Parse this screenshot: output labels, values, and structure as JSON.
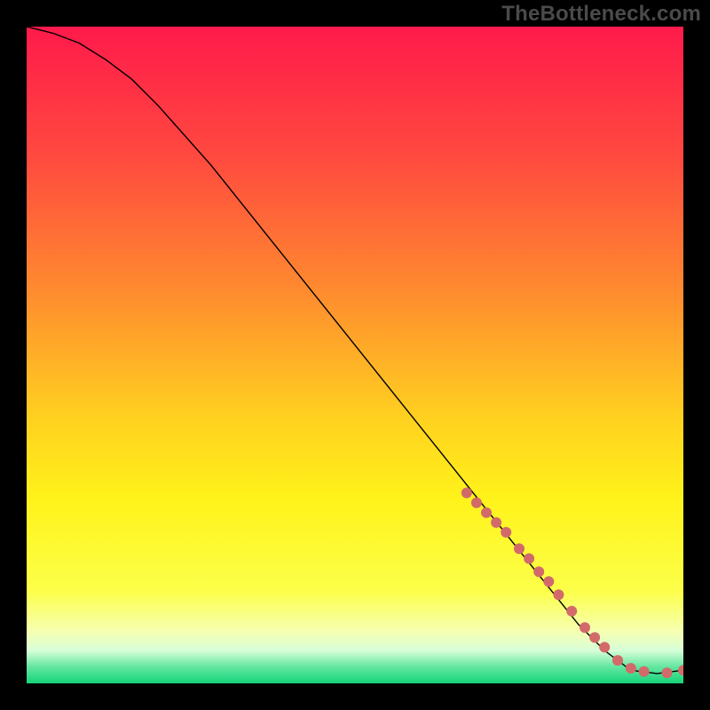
{
  "watermark": "TheBottleneck.com",
  "chart_data": {
    "type": "line",
    "title": "",
    "xlabel": "",
    "ylabel": "",
    "xlim": [
      0,
      100
    ],
    "ylim": [
      0,
      100
    ],
    "grid": false,
    "legend": false,
    "background_gradient": {
      "stops": [
        {
          "offset": 0.0,
          "color": "#ff1a4b"
        },
        {
          "offset": 0.2,
          "color": "#ff4a3f"
        },
        {
          "offset": 0.4,
          "color": "#ff8a2f"
        },
        {
          "offset": 0.6,
          "color": "#ffd21f"
        },
        {
          "offset": 0.72,
          "color": "#fff31a"
        },
        {
          "offset": 0.86,
          "color": "#fcff4a"
        },
        {
          "offset": 0.92,
          "color": "#f6ffb0"
        },
        {
          "offset": 0.95,
          "color": "#d8ffd8"
        },
        {
          "offset": 0.975,
          "color": "#62e6a0"
        },
        {
          "offset": 1.0,
          "color": "#15d47a"
        }
      ]
    },
    "series": [
      {
        "name": "bottleneck-curve",
        "stroke": "#000000",
        "strokeWidth": 1.4,
        "x": [
          0,
          4,
          8,
          12,
          16,
          20,
          24,
          28,
          32,
          36,
          40,
          44,
          48,
          52,
          56,
          60,
          64,
          68,
          72,
          76,
          80,
          84,
          88,
          92,
          96,
          100
        ],
        "y": [
          100,
          99,
          97.5,
          95,
          92,
          88,
          83.5,
          79,
          74,
          69,
          64,
          59,
          54,
          49,
          44,
          39,
          34,
          29,
          24,
          19,
          14,
          9,
          5,
          2,
          1.5,
          2
        ]
      },
      {
        "name": "highlight-points",
        "type": "scatter",
        "stroke": "none",
        "fill": "#d36a6a",
        "radius": 6,
        "x": [
          67,
          68.5,
          70,
          71.5,
          73,
          75,
          76.5,
          78,
          79.5,
          81,
          83,
          85,
          86.5,
          88,
          90,
          92,
          94,
          97.5,
          100
        ],
        "y": [
          29,
          27.5,
          26,
          24.5,
          23,
          20.5,
          19,
          17,
          15.5,
          13.5,
          11,
          8.5,
          7,
          5.5,
          3.5,
          2.3,
          1.8,
          1.6,
          2
        ]
      }
    ]
  }
}
